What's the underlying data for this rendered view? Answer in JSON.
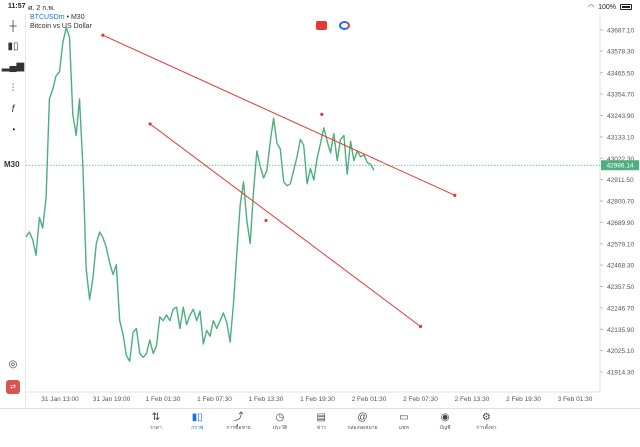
{
  "status": {
    "time": "11:57",
    "date": "ศ. 2 ก.พ.",
    "battery": "100%"
  },
  "header": {
    "symbol": "BTCUSDm",
    "timeframe": "M30",
    "description": "Bitcoin vs US Dollar",
    "separator": " • "
  },
  "toolbar": {
    "timeframe_label": "M30"
  },
  "chart_data": {
    "type": "line",
    "symbol": "BTCUSDm",
    "timeframe": "M30",
    "current_price": "42986.14",
    "y_ticks": [
      "43687.10",
      "43578.30",
      "43465.50",
      "43354.70",
      "43243.90",
      "43133.10",
      "43022.30",
      "42911.50",
      "42800.70",
      "42689.90",
      "42579.10",
      "42468.30",
      "42357.50",
      "42246.70",
      "42135.90",
      "42025.10",
      "41914.30"
    ],
    "x_ticks": [
      "31 Jan 13:00",
      "31 Jan 19:00",
      "1 Feb 01:30",
      "1 Feb 07:30",
      "1 Feb 13:30",
      "1 Feb 19:30",
      "2 Feb 01:30",
      "2 Feb 07:30",
      "2 Feb 13:30",
      "2 Feb 19:30",
      "3 Feb 01:30"
    ],
    "ylim": [
      41914.3,
      43700
    ],
    "series": [
      {
        "values": [
          42615,
          42640,
          42600,
          42520,
          42715,
          42660,
          42820,
          43330,
          43380,
          43450,
          43470,
          43620,
          43700,
          43650,
          43250,
          43140,
          43330,
          42980,
          42450,
          42290,
          42400,
          42580,
          42640,
          42610,
          42560,
          42480,
          42420,
          42470,
          42180,
          42110,
          42000,
          41970,
          42120,
          42140,
          42010,
          41990,
          42010,
          42080,
          42010,
          42050,
          42200,
          42180,
          42210,
          42180,
          42240,
          42250,
          42140,
          42250,
          42160,
          42210,
          42240,
          42180,
          42230,
          42060,
          42130,
          42100,
          42180,
          42140,
          42180,
          42220,
          42170,
          42070,
          42270,
          42530,
          42780,
          42900,
          42700,
          42580,
          42850,
          43060,
          42980,
          42920,
          42960,
          43110,
          43230,
          43100,
          43070,
          42900,
          42880,
          42890,
          42960,
          43030,
          43120,
          43090,
          42890,
          42970,
          42910,
          43020,
          43100,
          43180,
          43110,
          43050,
          43150,
          43010,
          43120,
          43140,
          42940,
          43110,
          43010,
          43060,
          43030,
          43040,
          43000,
          42990,
          42960
        ]
      }
    ],
    "trendlines": [
      {
        "start": [
          "31 Jan 18:00",
          43660
        ],
        "mid": [
          "1 Feb 19:30",
          43250
        ],
        "end": [
          "2 Feb 11:00",
          42830
        ]
      },
      {
        "start": [
          "31 Jan 23:30",
          43200
        ],
        "mid": [
          "1 Feb 13:00",
          42700
        ],
        "end": [
          "2 Feb 07:00",
          42150
        ]
      }
    ]
  },
  "bottom_nav": [
    {
      "label": "ราคา",
      "icon": "quotes-icon"
    },
    {
      "label": "กราฟ",
      "icon": "chart-icon",
      "active": true
    },
    {
      "label": "การซื้อขาย",
      "icon": "trade-icon"
    },
    {
      "label": "ประวัติ",
      "icon": "history-icon"
    },
    {
      "label": "ข่าว",
      "icon": "news-icon"
    },
    {
      "label": "กล่องจดหมาย",
      "icon": "mailbox-icon"
    },
    {
      "label": "แชท",
      "icon": "chat-icon"
    },
    {
      "label": "บัญชี",
      "icon": "account-icon"
    },
    {
      "label": "การตั้งค่า",
      "icon": "settings-icon"
    }
  ]
}
